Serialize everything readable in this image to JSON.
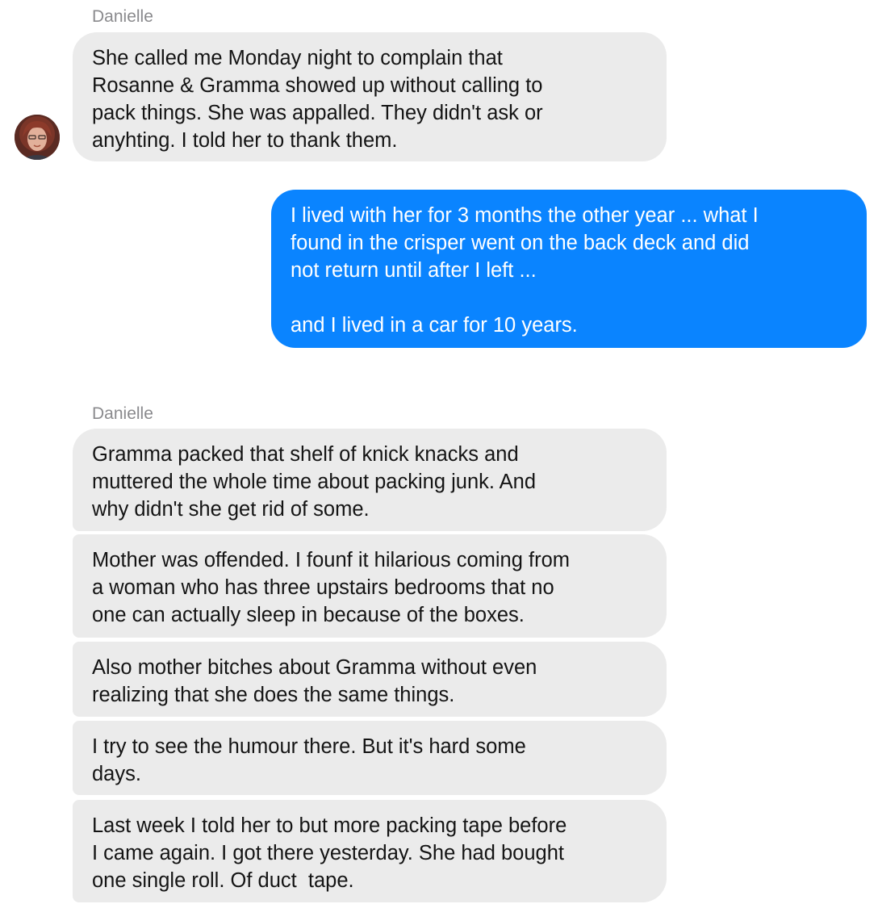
{
  "conversation": {
    "first_group": {
      "sender": "Danielle",
      "messages": [
        "She called me Monday night to complain that\nRosanne & Gramma showed up without calling to\npack things. She was appalled. They didn't ask or\nanyhting. I told her to thank them."
      ]
    },
    "outgoing": {
      "messages": [
        "I lived with her for 3 months the other year ... what I\nfound in the crisper went on the back deck and did\nnot return until after I left ...\n\nand I lived in a car for 10 years."
      ]
    },
    "second_group": {
      "sender": "Danielle",
      "messages": [
        "Gramma packed that shelf of knick knacks and\nmuttered the whole time about packing junk. And\nwhy didn't she get rid of some.",
        "Mother was offended. I founf it hilarious coming from\na woman who has three upstairs bedrooms that no\none can actually sleep in because of the boxes.",
        "Also mother bitches about Gramma without even\nrealizing that she does the same things.",
        "I try to see the humour there. But it's hard some\ndays.",
        "Last week I told her to but more packing tape before\nI came again. I got there yesterday. She had bought\none single roll. Of duct  tape."
      ]
    }
  },
  "colors": {
    "incoming_bubble": "#ebebeb",
    "outgoing_bubble": "#0a84ff",
    "sender_name": "#8a8a8d"
  },
  "icons": {
    "avatar": "contact-avatar"
  }
}
